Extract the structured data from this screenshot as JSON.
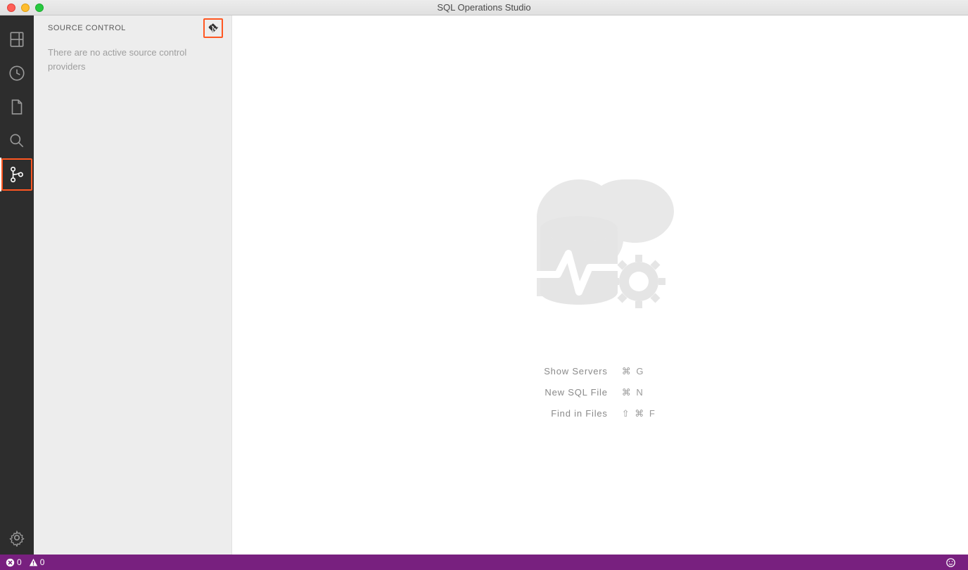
{
  "window": {
    "title": "SQL Operations Studio"
  },
  "panel": {
    "title": "SOURCE CONTROL",
    "message": "There are no active source control providers"
  },
  "welcome": {
    "shortcuts": [
      {
        "label": "Show Servers",
        "key": "⌘ G"
      },
      {
        "label": "New SQL File",
        "key": "⌘ N"
      },
      {
        "label": "Find in Files",
        "key": "⇧ ⌘ F"
      }
    ]
  },
  "status": {
    "errors": "0",
    "warnings": "0"
  }
}
